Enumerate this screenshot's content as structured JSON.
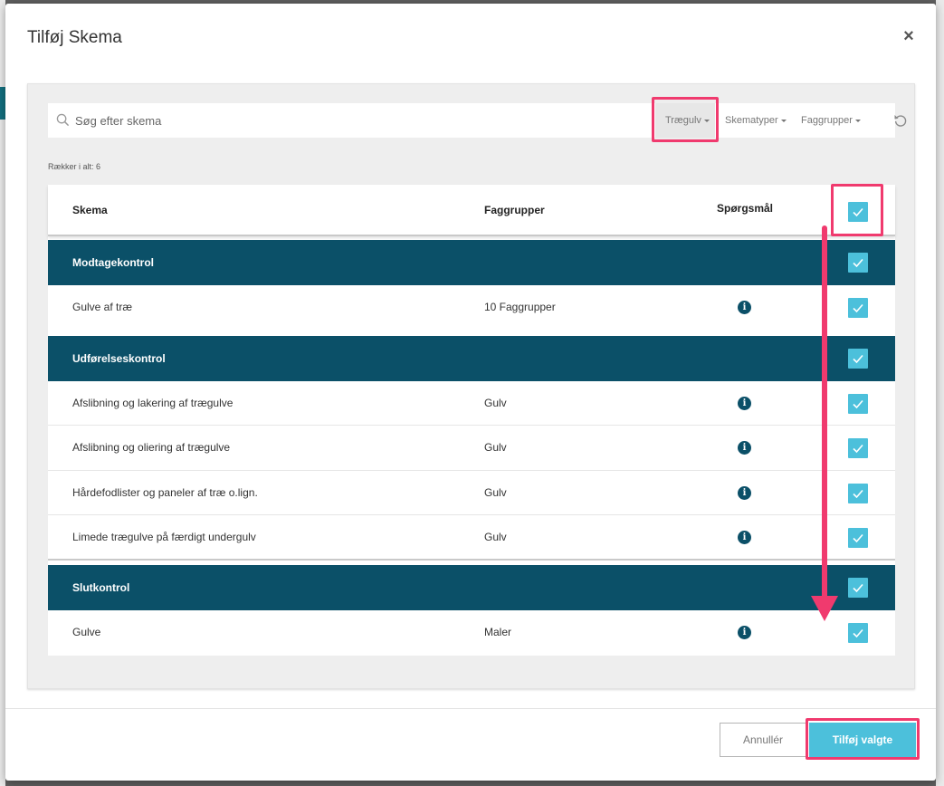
{
  "modal": {
    "title": "Tilføj Skema",
    "close_glyph": "×"
  },
  "search": {
    "placeholder": "Søg efter skema"
  },
  "filters": [
    {
      "label": "Trægulv"
    },
    {
      "label": "Skematyper"
    },
    {
      "label": "Faggrupper"
    }
  ],
  "row_count": "Rækker i alt: 6",
  "table": {
    "headers": {
      "skema": "Skema",
      "faggrupper": "Faggrupper",
      "questions": "Spørgsmål"
    },
    "groups": [
      {
        "name": "Modtagekontrol",
        "rows": [
          {
            "skema": "Gulve af træ",
            "faggruppe": "10 Faggrupper"
          }
        ]
      },
      {
        "name": "Udførelseskontrol",
        "rows": [
          {
            "skema": "Afslibning og lakering af trægulve",
            "faggruppe": "Gulv"
          },
          {
            "skema": "Afslibning og oliering af trægulve",
            "faggruppe": "Gulv"
          },
          {
            "skema": "Hårdefodlister og paneler af træ o.lign.",
            "faggruppe": "Gulv"
          },
          {
            "skema": "Limede trægulve på færdigt undergulv",
            "faggruppe": "Gulv"
          }
        ]
      },
      {
        "name": "Slutkontrol",
        "rows": [
          {
            "skema": "Gulve",
            "faggruppe": "Maler"
          }
        ]
      }
    ]
  },
  "footer": {
    "cancel_label": "Annullér",
    "add_label": "Tilføj valgte"
  },
  "colors": {
    "group_bg": "#0b5068",
    "accent": "#4cc0db",
    "annotation": "#f03a6e"
  },
  "icons": {
    "search": "search-icon",
    "reset": "reset-icon",
    "info": "info-icon",
    "check": "check-icon",
    "close": "close-icon"
  }
}
